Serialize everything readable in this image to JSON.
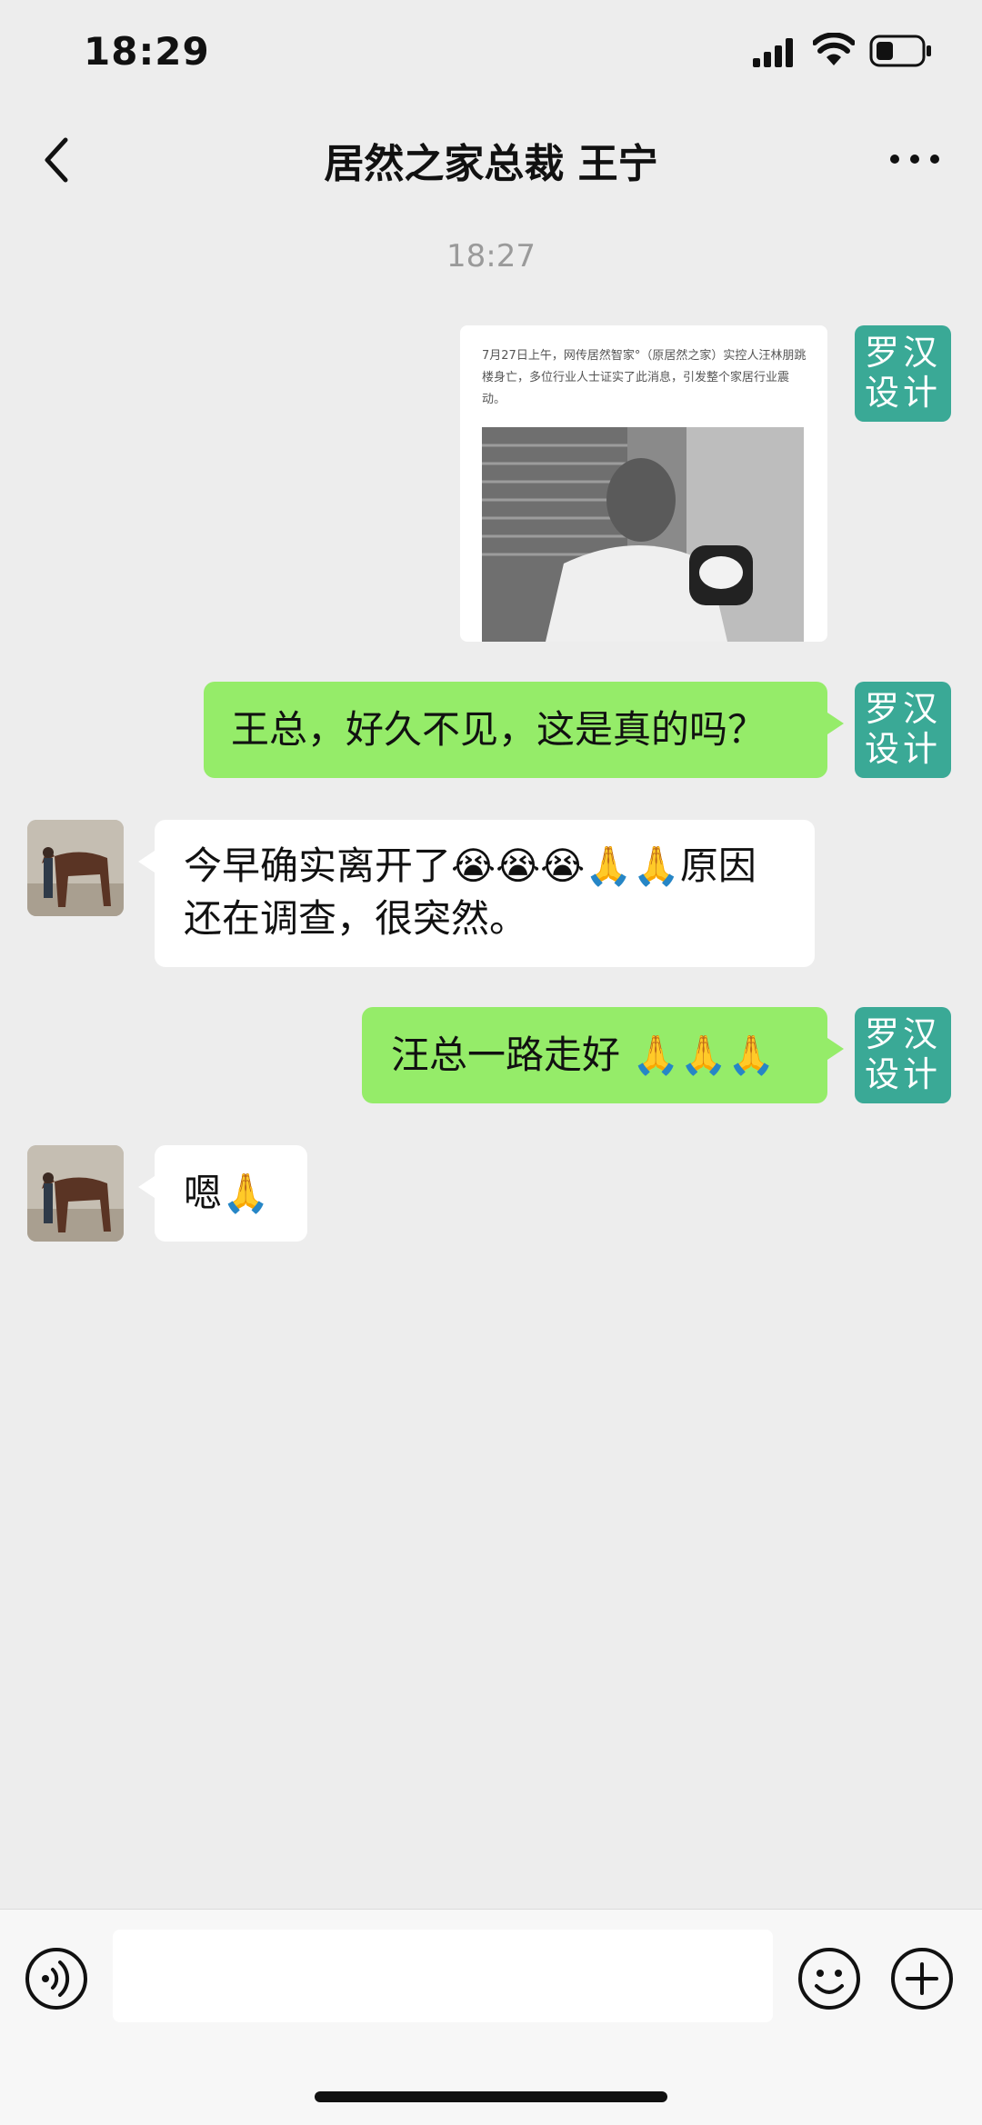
{
  "status_bar": {
    "time": "18:29"
  },
  "nav": {
    "title": "居然之家总裁 王宁"
  },
  "chat": {
    "timestamp": "18:27",
    "self_avatar_text": "罗汉设计",
    "image_message": {
      "caption": "7月27日上午，网传居然智家°（原居然之家）实控人汪林朋跳楼身亡，多位行业人士证实了此消息，引发整个家居行业震动。"
    },
    "messages": [
      {
        "sender": "self",
        "text": "王总，好久不见，这是真的吗？"
      },
      {
        "sender": "other",
        "text": "今早确实离开了😭😭😭🙏🙏原因还在调查，很突然。"
      },
      {
        "sender": "self",
        "text": "汪总一路走好 🙏🙏🙏"
      },
      {
        "sender": "other",
        "text": "嗯🙏"
      }
    ]
  },
  "input_bar": {
    "text_value": ""
  },
  "colors": {
    "self_bubble": "#95ec69",
    "other_bubble": "#ffffff",
    "self_avatar": "#3aa996",
    "background": "#ededed"
  },
  "icons": [
    "signal-icon",
    "wifi-icon",
    "battery-icon",
    "back-arrow-icon",
    "more-icon",
    "voice-icon",
    "emoji-icon",
    "plus-icon"
  ]
}
